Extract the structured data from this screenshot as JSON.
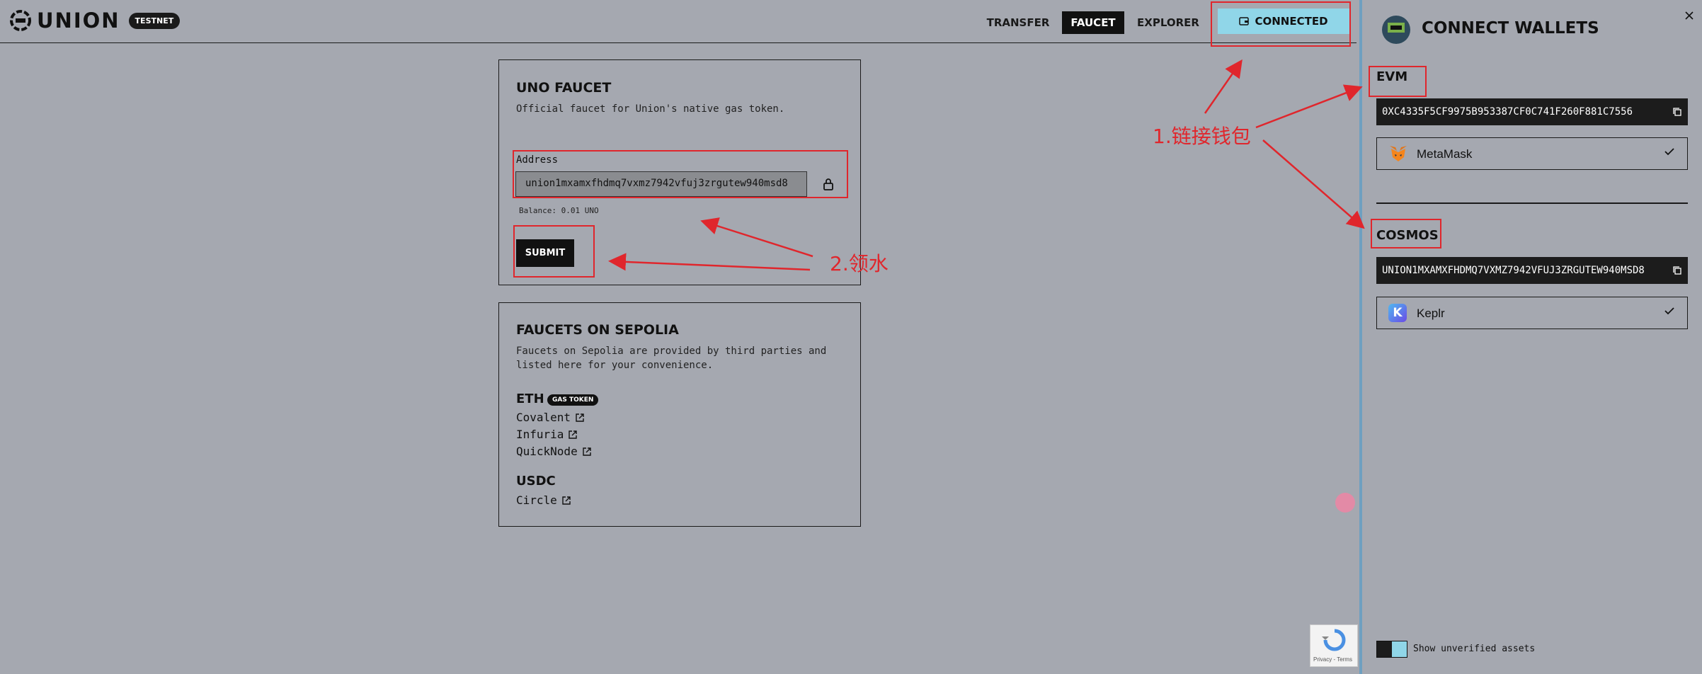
{
  "header": {
    "logo_text": "UNION",
    "badge": "TESTNET",
    "nav": {
      "transfer": "TRANSFER",
      "faucet": "FAUCET",
      "explorer": "EXPLORER",
      "connected": "CONNECTED"
    }
  },
  "uno_faucet": {
    "title": "UNO FAUCET",
    "description": "Official faucet for Union's native gas token.",
    "address_label": "Address",
    "address_value": "union1mxamxfhdmq7vxmz7942vfuj3zrgutew940msd8",
    "balance": "Balance: 0.01 UNO",
    "submit": "SUBMIT"
  },
  "sepolia": {
    "title": "FAUCETS ON SEPOLIA",
    "description_line1": "Faucets on Sepolia are provided by third parties and",
    "description_line2": "listed here for your convenience.",
    "eth_title": "ETH",
    "gas_badge": "GAS TOKEN",
    "eth_links": [
      "Covalent",
      "Infuria",
      "QuickNode"
    ],
    "usdc_title": "USDC",
    "usdc_links": [
      "Circle"
    ]
  },
  "wallet_panel": {
    "title": "CONNECT WALLETS",
    "evm_title": "EVM",
    "evm_address": "0XC4335F5CF9975B953387CF0C741F260F881C7556",
    "evm_wallet": "MetaMask",
    "cosmos_title": "COSMOS",
    "cosmos_address": "UNION1MXAMXFHDMQ7VXMZ7942VFUJ3ZRGUTEW940MSD8",
    "cosmos_wallet": "Keplr",
    "toggle_label": "Show unverified assets"
  },
  "annotations": {
    "step1": "1.链接钱包",
    "step2": "2.领水"
  },
  "recaptcha": {
    "text": "Privacy - Terms"
  },
  "colors": {
    "background": "#a5a8b0",
    "accent": "#90d6e8",
    "annotation": "#e0262c"
  }
}
